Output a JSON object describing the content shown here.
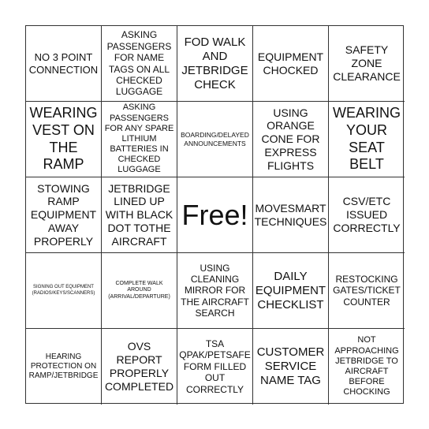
{
  "card": {
    "cells": [
      "NO 3 POINT CONNECTION",
      "ASKING PASSENGERS FOR NAME TAGS ON ALL CHECKED LUGGAGE",
      "FOD WALK AND JETBRIDGE CHECK",
      "EQUIPMENT CHOCKED",
      "SAFETY ZONE CLEARANCE",
      "WEARING VEST ON THE RAMP",
      "ASKING PASSENGERS FOR ANY SPARE LITHIUM BATTERIES IN CHECKED LUGGAGE",
      "BOARDING/DELAYED ANNOUNCEMENTS",
      "USING ORANGE CONE FOR EXPRESS FLIGHTS",
      "WEARING YOUR SEAT BELT",
      "STOWING RAMP EQUIPMENT AWAY PROPERLY",
      "JETBRIDGE LINED UP WITH BLACK DOT TOTHE AIRCRAFT",
      "Free!",
      "MOVESMART TECHNIQUES",
      "CSV/ETC ISSUED CORRECTLY",
      "SIGNING OUT EQUIPMENT (RADIOS/KEYS/SCANNERS)",
      "COMPLETE WALK AROUND (ARRIVAL/DEPARTURE)",
      "USING CLEANING MIRROR FOR THE AIRCRAFT SEARCH",
      "DAILY EQUIPMENT CHECKLIST",
      "RESTOCKING GATES/TICKET COUNTER",
      "HEARING PROTECTION ON RAMP/JETBRIDGE",
      "OVS REPORT PROPERLY COMPLETED",
      "TSA QPAK/PETSAFE FORM FILLED OUT CORRECTLY",
      "CUSTOMER SERVICE NAME TAG",
      "NOT APPROACHING JETBRIDGE TO AIRCRAFT BEFORE CHOCKING"
    ]
  }
}
